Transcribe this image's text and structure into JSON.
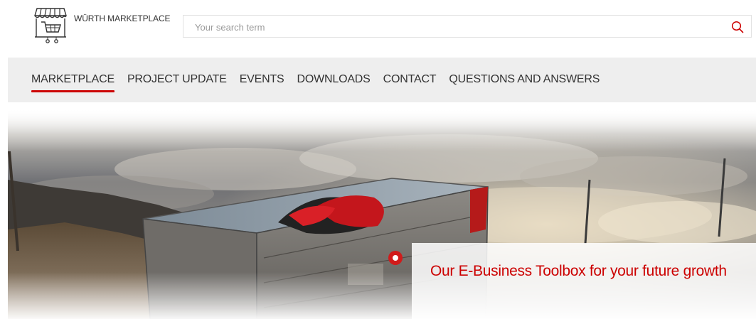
{
  "header": {
    "logo_text": "WÜRTH MARKETPLACE",
    "search_placeholder": "Your search term"
  },
  "nav": {
    "items": [
      {
        "label": "MARKETPLACE",
        "active": true
      },
      {
        "label": "PROJECT UPDATE",
        "active": false
      },
      {
        "label": "EVENTS",
        "active": false
      },
      {
        "label": "DOWNLOADS",
        "active": false
      },
      {
        "label": "CONTACT",
        "active": false
      },
      {
        "label": "QUESTIONS AND ANSWERS",
        "active": false
      }
    ]
  },
  "hero": {
    "headline": "Our E-Business Toolbox for your future growth"
  },
  "colors": {
    "accent": "#cc0000",
    "nav_background": "#eeeeee"
  },
  "icons": {
    "logo": "shop-cart-icon",
    "search": "search-icon"
  }
}
